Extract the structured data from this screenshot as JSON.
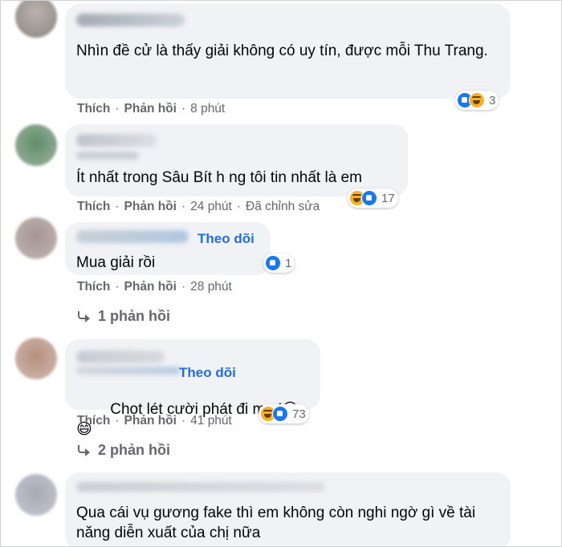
{
  "labels": {
    "like": "Thích",
    "reply": "Phản hồi",
    "dot": "·",
    "follow": "Theo dõi"
  },
  "comments": [
    {
      "text": "Nhìn đề cử là thấy giải không có uy tín, được mỗi Thu Trang.",
      "time": "8 phút",
      "reactions": [
        "like",
        "haha"
      ],
      "reaction_count": "3"
    },
    {
      "text": "Ít nhất trong Sâu Bít h ng tôi tin nhất là em",
      "time": "24 phút",
      "edited": "Đã chỉnh sửa",
      "reactions": [
        "haha",
        "like"
      ],
      "reaction_count": "17"
    },
    {
      "text": "Mua giải rồi",
      "time": "28 phút",
      "reactions": [
        "like"
      ],
      "reaction_count": "1",
      "replies": "1 phản hồi"
    },
    {
      "text": "Chọt lét cười phát đi m.n!",
      "emoji": "😄😄",
      "time": "41 phút",
      "reactions": [
        "haha",
        "like"
      ],
      "reaction_count": "73",
      "replies": "2 phản hồi"
    },
    {
      "text": "Qua cái vụ gương fake thì em không còn nghi ngờ gì về tài năng diễn xuất của chị nữa"
    }
  ],
  "colors": {
    "bubble": "#f0f2f5",
    "link": "#216fdb",
    "meta": "#65676b",
    "like": "#1877f2",
    "haha": "#f7b125"
  }
}
